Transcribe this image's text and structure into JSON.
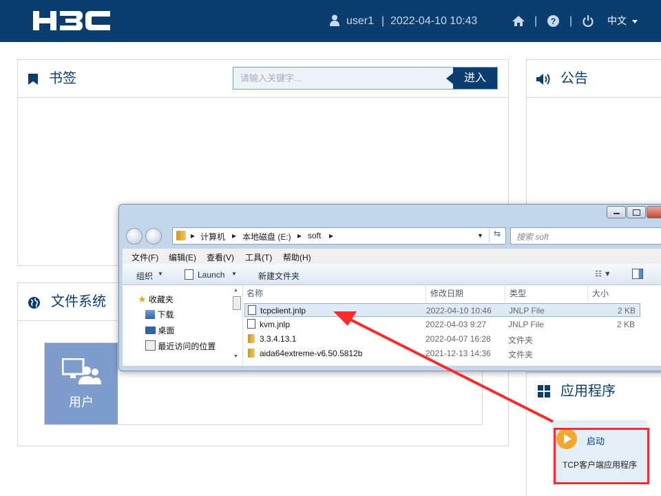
{
  "header": {
    "logo_text": "H3C",
    "user": "user1",
    "separator": "|",
    "datetime": "2022-04-10 10:43",
    "language": "中文",
    "colors": {
      "bar": "#0b3e6f"
    }
  },
  "bookmark_panel": {
    "title": "书签",
    "search_placeholder": "请输入关键字...",
    "enter_label": "进入"
  },
  "notice_panel": {
    "title": "公告"
  },
  "filesystem_panel": {
    "title": "文件系统",
    "tile_label": "用户"
  },
  "apps_panel": {
    "title": "应用程序",
    "launch_label": "启动",
    "app_name": "TCP客户端应用程序"
  },
  "explorer": {
    "breadcrumb": [
      "计算机",
      "本地磁盘 (E:)",
      "soft"
    ],
    "search_placeholder": "搜索 soft",
    "menu": [
      "文件(F)",
      "编辑(E)",
      "查看(V)",
      "工具(T)",
      "帮助(H)"
    ],
    "toolbar": {
      "organize": "组织",
      "launch": "Launch",
      "new_folder": "新建文件夹"
    },
    "nav": [
      "收藏夹",
      "下载",
      "桌面",
      "最近访问的位置"
    ],
    "columns": {
      "name": "名称",
      "modified": "修改日期",
      "type": "类型",
      "size": "大小"
    },
    "files": [
      {
        "name": "tcpclient.jnlp",
        "modified": "2022-04-10 10:46",
        "type": "JNLP File",
        "size": "2 KB",
        "icon": "jnlp-file-icon"
      },
      {
        "name": "kvm.jnlp",
        "modified": "2022-04-03 9:27",
        "type": "JNLP File",
        "size": "2 KB",
        "icon": "jnlp-file-icon"
      },
      {
        "name": "3.3.4.13.1",
        "modified": "2022-04-07 16:28",
        "type": "文件夹",
        "size": "",
        "icon": "folder-icon"
      },
      {
        "name": "aida64extreme-v6.50.5812b",
        "modified": "2021-12-13 14:36",
        "type": "文件夹",
        "size": "",
        "icon": "folder-icon"
      }
    ]
  }
}
